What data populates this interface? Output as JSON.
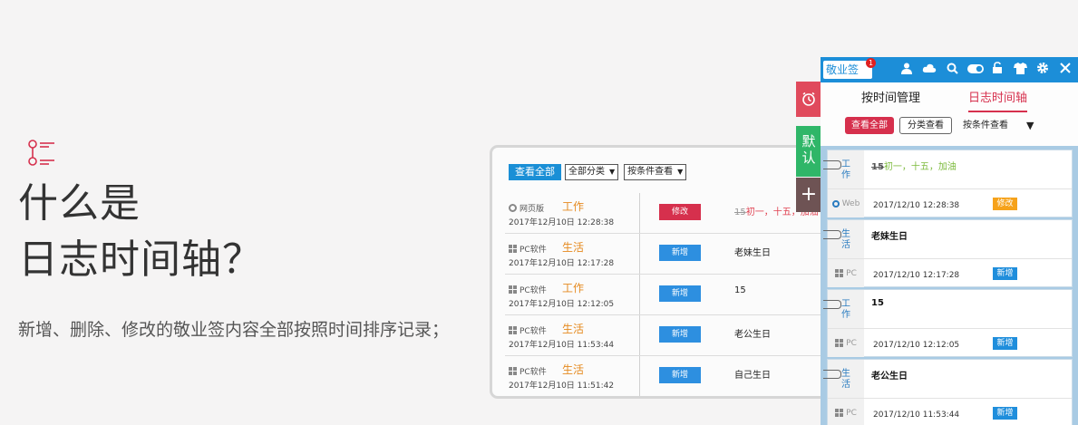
{
  "hero": {
    "title_line1": "什么是",
    "title_line2": "日志时间轴？",
    "description": "新增、删除、修改的敬业签内容全部按照时间排序记录；"
  },
  "main_window": {
    "toolbar": {
      "view_all": "查看全部",
      "category_select": "全部分类",
      "condition_select": "按条件查看"
    },
    "rows": [
      {
        "source": "网页版",
        "source_icon": "ie-icon",
        "category": "工作",
        "time": "2017年12月10日 12:28:38",
        "action": "修改",
        "action_type": "edit",
        "text_strike": "15",
        "text_main": "初一，十五，加油",
        "text_highlight": true
      },
      {
        "source": "PC软件",
        "source_icon": "windows-icon",
        "category": "生活",
        "time": "2017年12月10日 12:17:28",
        "action": "新增",
        "action_type": "add",
        "text_main": "老妹生日"
      },
      {
        "source": "PC软件",
        "source_icon": "windows-icon",
        "category": "工作",
        "time": "2017年12月10日 12:12:05",
        "action": "新增",
        "action_type": "add",
        "text_main": "15"
      },
      {
        "source": "PC软件",
        "source_icon": "windows-icon",
        "category": "生活",
        "time": "2017年12月10日 11:53:44",
        "action": "新增",
        "action_type": "add",
        "text_main": "老公生日"
      },
      {
        "source": "PC软件",
        "source_icon": "windows-icon",
        "category": "生活",
        "time": "2017年12月10日 11:51:42",
        "action": "新增",
        "action_type": "add",
        "text_main": "自己生日"
      }
    ]
  },
  "side_tabs": {
    "alarm_icon": "alarm-clock-icon",
    "default_tab": "默认",
    "add_icon": "plus-icon"
  },
  "panel": {
    "logo": "敬业签",
    "badge_count": "1",
    "header_icons": [
      "user-icon",
      "cloud-icon",
      "search-icon",
      "toggle-icon",
      "lock-icon",
      "shirt-icon",
      "gear-icon",
      "close-icon"
    ],
    "tab_time": "按时间管理",
    "tab_timeline": "日志时间轴",
    "filter_all": "查看全部",
    "filter_category": "分类查看",
    "filter_condition": "按条件查看",
    "cards": [
      {
        "category": "工作",
        "content_strike": "15",
        "content_main": "初一，十五，加油",
        "source": "Web",
        "time": "2017/12/10 12:28:38",
        "tag": "修改",
        "tag_type": "edit"
      },
      {
        "category": "生活",
        "content_main": "老妹生日",
        "source": "PC",
        "time": "2017/12/10 12:17:28",
        "tag": "新增",
        "tag_type": "add"
      },
      {
        "category": "工作",
        "content_main": "15",
        "source": "PC",
        "time": "2017/12/10 12:12:05",
        "tag": "新增",
        "tag_type": "add"
      },
      {
        "category": "生活",
        "content_main": "老公生日",
        "source": "PC",
        "time": "2017/12/10 11:53:44",
        "tag": "新增",
        "tag_type": "add"
      }
    ]
  },
  "colors": {
    "brand_blue": "#1c8ed8",
    "accent_red": "#d6304d",
    "accent_orange": "#e58a1f",
    "green": "#2fb668"
  }
}
